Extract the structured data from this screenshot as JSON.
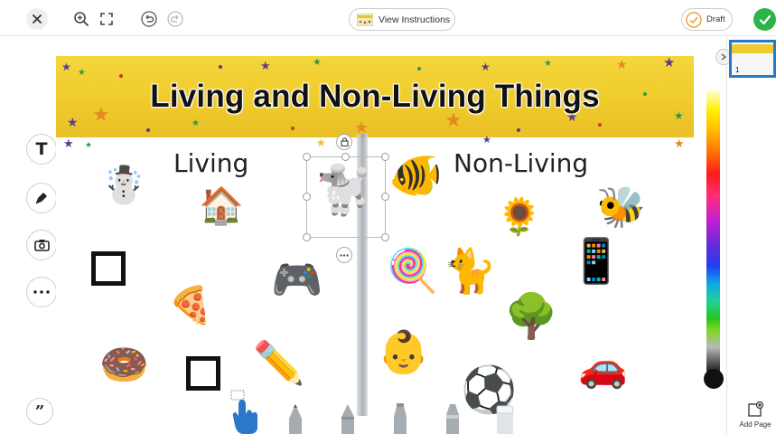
{
  "topbar": {
    "close_icon": "close-icon",
    "zoom_icon": "zoom-in-icon",
    "fullscreen_icon": "fullscreen-icon",
    "undo_icon": "undo-icon",
    "redo_icon": "redo-icon",
    "view_instructions_label": "View Instructions",
    "draft_label": "Draft",
    "submit_icon": "check-icon"
  },
  "tools": {
    "text_label": "T",
    "mic_icon": "microphone-icon",
    "camera_icon": "camera-icon",
    "more_icon": "more-icon",
    "quote_label": "”"
  },
  "canvas": {
    "banner_title": "Living and Non-Living Things",
    "living_label": "Living",
    "nonliving_label": "Non-Living",
    "emojis": {
      "snowman": "☃️",
      "house": "🏠",
      "poodle": "🐩",
      "fish": "🐠",
      "sunflower": "🌻",
      "bee": "🐝",
      "phone": "📱",
      "pizza": "🍕",
      "gamepad": "🎮",
      "lollipop": "🍭",
      "cat": "🐈",
      "tree": "🌳",
      "baby": "👶",
      "donut": "🍩",
      "pencil": "✏️",
      "soccer": "⚽",
      "car": "🚗"
    }
  },
  "right_panel": {
    "page_number": "1",
    "add_page_label": "Add Page"
  },
  "colors": {
    "accent": "#2a78c8",
    "submit": "#2db34a",
    "banner": "#f0cc2c"
  }
}
